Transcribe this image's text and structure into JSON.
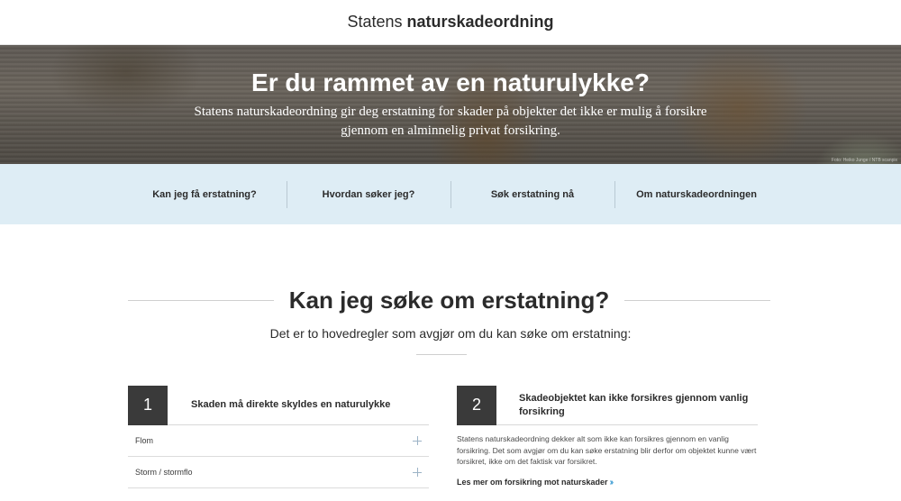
{
  "header": {
    "logo_regular": "Statens",
    "logo_bold": "naturskadeordning"
  },
  "hero": {
    "title": "Er du rammet av en naturulykke?",
    "text": "Statens naturskadeordning gir deg erstatning for skader på objekter det ikke er mulig å forsikre gjennom en alminnelig privat forsikring.",
    "credit": "Foto: Heiko Junge / NTB scanpix"
  },
  "nav": {
    "items": [
      {
        "label": "Kan jeg få erstatning?"
      },
      {
        "label": "Hvordan søker jeg?"
      },
      {
        "label": "Søk erstatning nå"
      },
      {
        "label": "Om naturskadeordningen"
      }
    ]
  },
  "section": {
    "title": "Kan jeg søke om erstatning?",
    "subtitle": "Det er to hovedregler som avgjør om du kan søke om erstatning:"
  },
  "rules": [
    {
      "number": "1",
      "title": "Skaden må direkte skyldes en naturulykke",
      "items": [
        {
          "label": "Flom"
        },
        {
          "label": "Storm / stormflo"
        }
      ]
    },
    {
      "number": "2",
      "title": "Skadeobjektet kan ikke forsikres gjennom vanlig forsikring",
      "body": "Statens naturskadeordning dekker alt som ikke kan forsikres gjennom en vanlig forsikring. Det som avgjør om du kan søke erstatning blir derfor om objektet kunne vært forsikret, ikke om det faktisk var forsikret.",
      "link": "Les mer om forsikring mot naturskader"
    }
  ],
  "colors": {
    "nav_bg": "#deedf5",
    "accent": "#4aa3d6",
    "dark_box": "#3a3a3a"
  },
  "icons": {
    "accordion": "plus-icon",
    "link": "chevron-double-right-icon"
  }
}
